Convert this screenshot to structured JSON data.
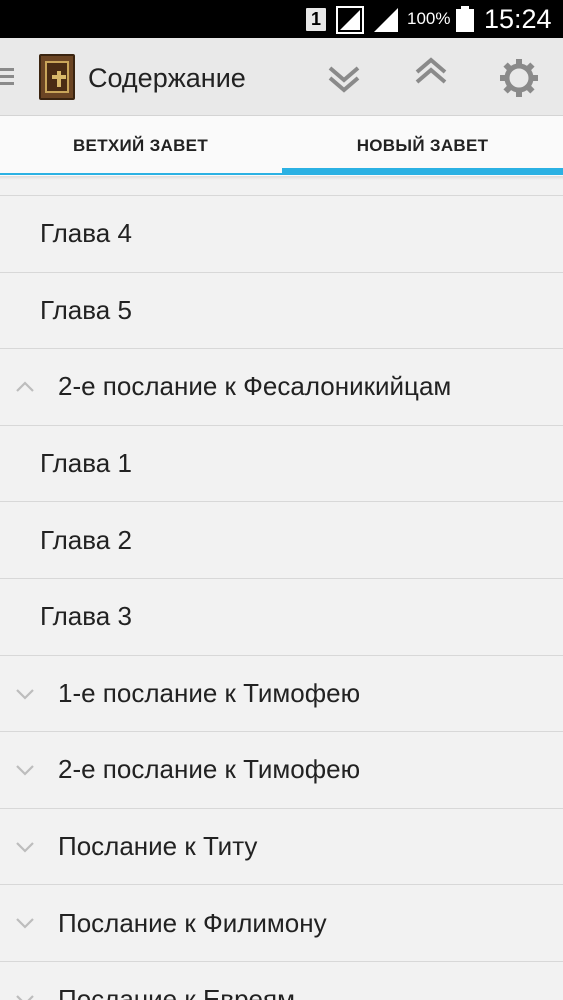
{
  "status_bar": {
    "sim": "1",
    "battery_percent": "100%",
    "time": "15:24"
  },
  "toolbar": {
    "title": "Содержание"
  },
  "tabs": [
    {
      "label": "ВЕТХИЙ ЗАВЕТ",
      "selected": false
    },
    {
      "label": "НОВЫЙ ЗАВЕТ",
      "selected": true
    }
  ],
  "list": {
    "items": [
      {
        "type": "chapter",
        "label": "Глава 4"
      },
      {
        "type": "chapter",
        "label": "Глава 5"
      },
      {
        "type": "group",
        "label": "2-е послание к Фесалоникийцам",
        "expanded": true
      },
      {
        "type": "chapter",
        "label": "Глава 1"
      },
      {
        "type": "chapter",
        "label": "Глава 2"
      },
      {
        "type": "chapter",
        "label": "Глава 3"
      },
      {
        "type": "group",
        "label": "1-е послание к Тимофею",
        "expanded": false
      },
      {
        "type": "group",
        "label": "2-е послание к Тимофею",
        "expanded": false
      },
      {
        "type": "group",
        "label": "Послание к Титу",
        "expanded": false
      },
      {
        "type": "group",
        "label": "Послание к Филимону",
        "expanded": false
      },
      {
        "type": "group",
        "label": "Послание к Евреям",
        "expanded": false
      }
    ]
  },
  "colors": {
    "accent": "#2bb1e3",
    "toolbar_bg": "#e9e9e9",
    "list_bg": "#f2f2f2",
    "divider": "#d8d8d8"
  },
  "icons": {
    "menu": "drawer-icon",
    "app": "book-icon",
    "collapse_all": "double-chevron-down-icon",
    "expand_all": "double-chevron-up-icon",
    "settings": "gear-icon"
  }
}
